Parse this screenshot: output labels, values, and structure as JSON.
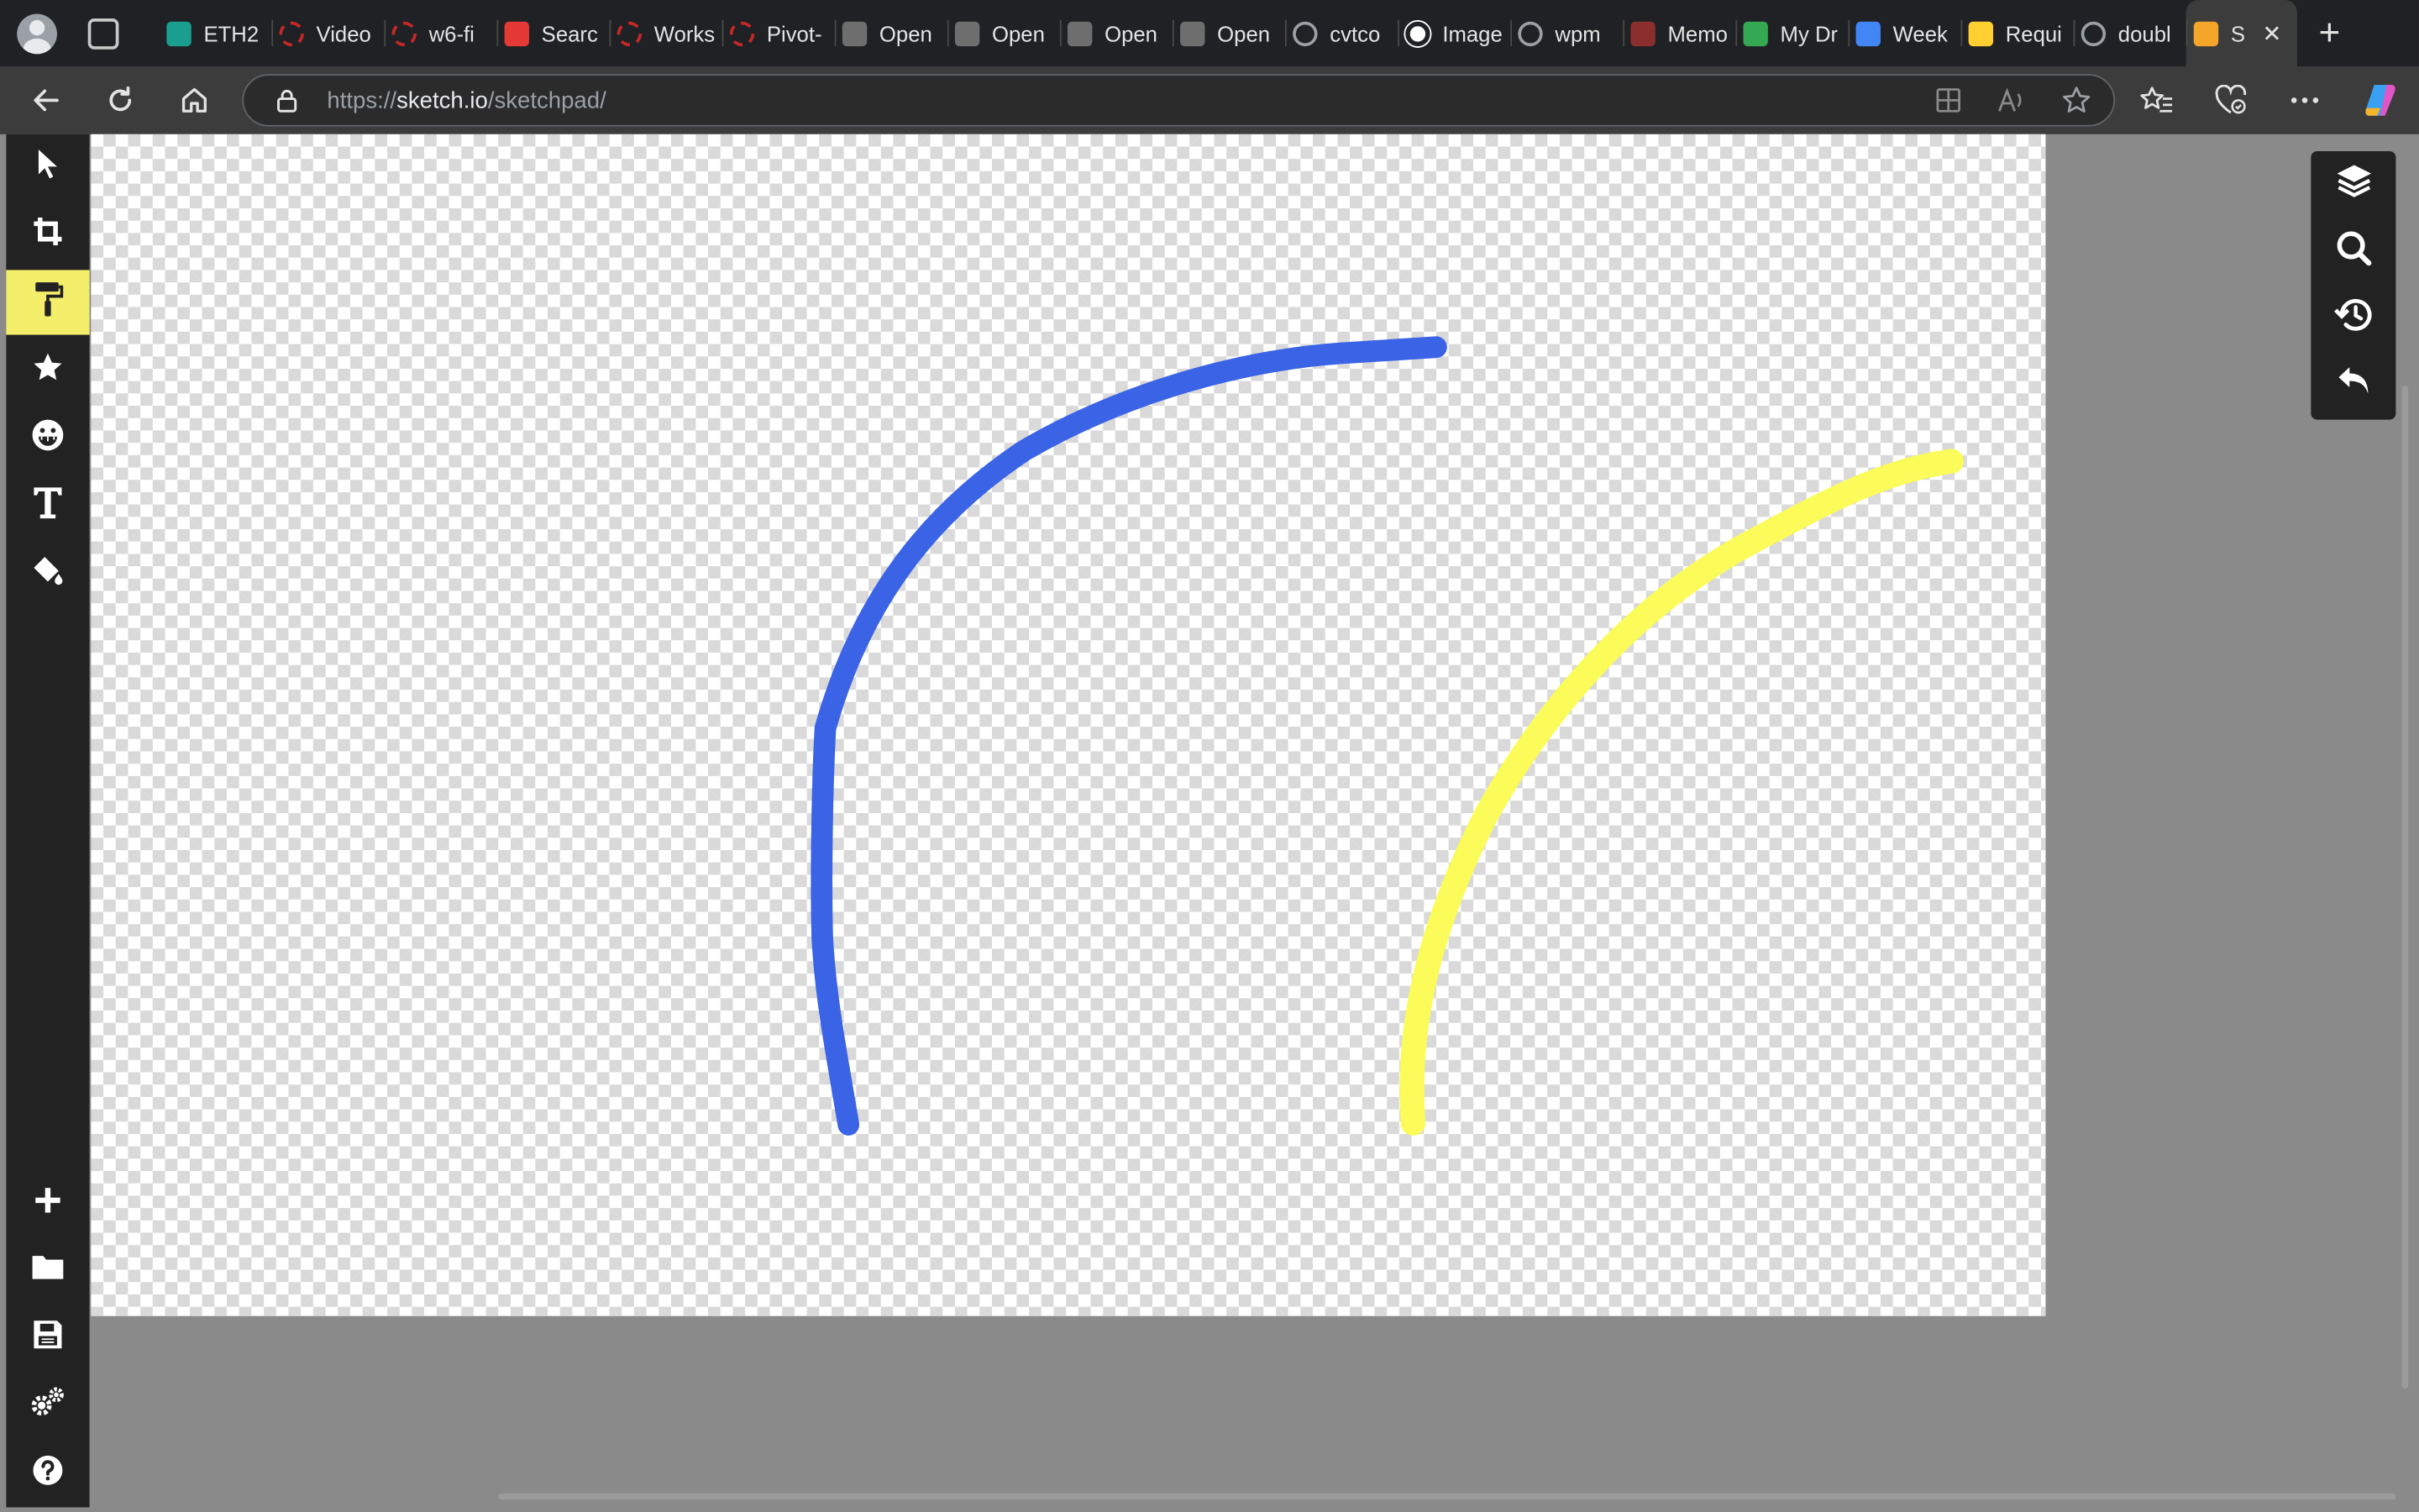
{
  "browser": {
    "tabs": [
      {
        "title": "ETH2",
        "icon": "eth2-favicon",
        "color": "#1a9e8f"
      },
      {
        "title": "Video",
        "icon": "openreview-favicon",
        "color": "#c62828"
      },
      {
        "title": "w6-fi",
        "icon": "openreview-favicon",
        "color": "#c62828"
      },
      {
        "title": "Searc",
        "icon": "search-favicon",
        "color": "#e53935"
      },
      {
        "title": "Works",
        "icon": "openreview-favicon",
        "color": "#c62828"
      },
      {
        "title": "Pivot-",
        "icon": "openreview-favicon",
        "color": "#c62828"
      },
      {
        "title": "Open",
        "icon": "github-favicon",
        "color": "#6e6e6e"
      },
      {
        "title": "Open",
        "icon": "github-favicon",
        "color": "#6e6e6e"
      },
      {
        "title": "Open",
        "icon": "github-favicon",
        "color": "#6e6e6e"
      },
      {
        "title": "Open",
        "icon": "github-favicon",
        "color": "#6e6e6e"
      },
      {
        "title": "cvtco",
        "icon": "google-favicon",
        "color": "#5f6368"
      },
      {
        "title": "Image",
        "icon": "openai-favicon",
        "color": "#ffffff"
      },
      {
        "title": "wpm",
        "icon": "google-favicon",
        "color": "#5f6368"
      },
      {
        "title": "Memo",
        "icon": "memo-favicon",
        "color": "#8b2e2e"
      },
      {
        "title": "My Dr",
        "icon": "drive-favicon",
        "color": "#34a853"
      },
      {
        "title": "Week",
        "icon": "docs-favicon",
        "color": "#4285f4"
      },
      {
        "title": "Requi",
        "icon": "miro-favicon",
        "color": "#ffd02f"
      },
      {
        "title": "doubl",
        "icon": "google-favicon",
        "color": "#5f6368"
      },
      {
        "title": "S",
        "icon": "sketch-favicon",
        "color": "#f4a62a",
        "active": true
      }
    ],
    "url_scheme": "https://",
    "url_host": "sketch.io",
    "url_path": "/sketchpad/"
  },
  "app": {
    "left_tools": [
      {
        "name": "select-tool",
        "icon": "pointer-icon"
      },
      {
        "name": "crop-tool",
        "icon": "crop-icon"
      },
      {
        "name": "paint-tool",
        "icon": "paint-roller-icon",
        "active": true
      },
      {
        "name": "stamp-tool",
        "icon": "star-icon"
      },
      {
        "name": "emoji-tool",
        "icon": "emoji-icon"
      },
      {
        "name": "text-tool",
        "icon": "text-icon"
      },
      {
        "name": "fill-tool",
        "icon": "paint-bucket-icon"
      }
    ],
    "bottom_tools": [
      {
        "name": "new-button",
        "icon": "plus-icon"
      },
      {
        "name": "open-button",
        "icon": "folder-icon"
      },
      {
        "name": "save-button",
        "icon": "save-icon"
      },
      {
        "name": "settings-button",
        "icon": "gears-icon"
      },
      {
        "name": "help-button",
        "icon": "question-icon"
      }
    ],
    "right_panel": [
      {
        "name": "layers-button",
        "icon": "layers-icon"
      },
      {
        "name": "zoom-button",
        "icon": "magnifier-icon"
      },
      {
        "name": "history-button",
        "icon": "history-icon"
      },
      {
        "name": "undo-button",
        "icon": "undo-icon"
      }
    ],
    "strokes": [
      {
        "name": "blue-stroke",
        "color": "#3a63e6"
      },
      {
        "name": "yellow-stroke",
        "color": "#fbfb5a"
      }
    ],
    "active_tool_color": "#f4ef6a"
  }
}
